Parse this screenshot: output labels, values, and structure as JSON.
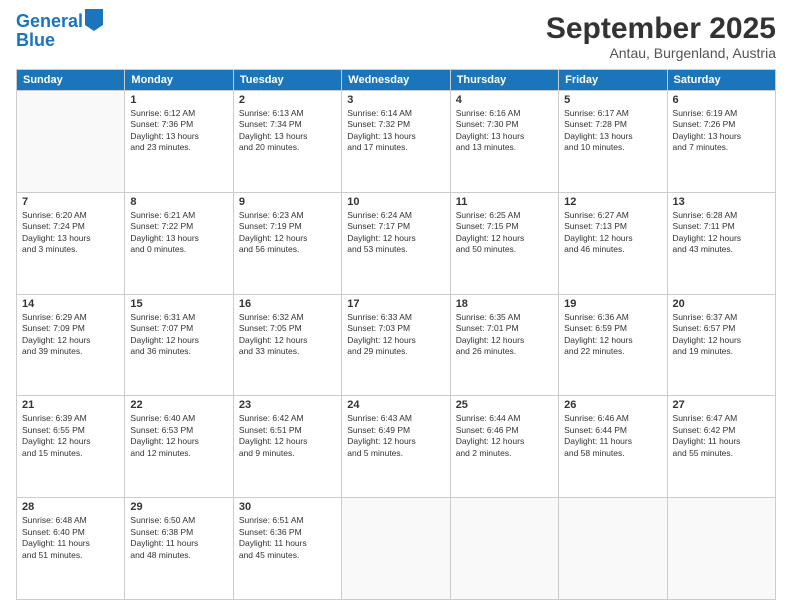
{
  "header": {
    "logo_line1": "General",
    "logo_line2": "Blue",
    "month": "September 2025",
    "location": "Antau, Burgenland, Austria"
  },
  "weekdays": [
    "Sunday",
    "Monday",
    "Tuesday",
    "Wednesday",
    "Thursday",
    "Friday",
    "Saturday"
  ],
  "weeks": [
    [
      {
        "day": "",
        "content": ""
      },
      {
        "day": "1",
        "content": "Sunrise: 6:12 AM\nSunset: 7:36 PM\nDaylight: 13 hours\nand 23 minutes."
      },
      {
        "day": "2",
        "content": "Sunrise: 6:13 AM\nSunset: 7:34 PM\nDaylight: 13 hours\nand 20 minutes."
      },
      {
        "day": "3",
        "content": "Sunrise: 6:14 AM\nSunset: 7:32 PM\nDaylight: 13 hours\nand 17 minutes."
      },
      {
        "day": "4",
        "content": "Sunrise: 6:16 AM\nSunset: 7:30 PM\nDaylight: 13 hours\nand 13 minutes."
      },
      {
        "day": "5",
        "content": "Sunrise: 6:17 AM\nSunset: 7:28 PM\nDaylight: 13 hours\nand 10 minutes."
      },
      {
        "day": "6",
        "content": "Sunrise: 6:19 AM\nSunset: 7:26 PM\nDaylight: 13 hours\nand 7 minutes."
      }
    ],
    [
      {
        "day": "7",
        "content": "Sunrise: 6:20 AM\nSunset: 7:24 PM\nDaylight: 13 hours\nand 3 minutes."
      },
      {
        "day": "8",
        "content": "Sunrise: 6:21 AM\nSunset: 7:22 PM\nDaylight: 13 hours\nand 0 minutes."
      },
      {
        "day": "9",
        "content": "Sunrise: 6:23 AM\nSunset: 7:19 PM\nDaylight: 12 hours\nand 56 minutes."
      },
      {
        "day": "10",
        "content": "Sunrise: 6:24 AM\nSunset: 7:17 PM\nDaylight: 12 hours\nand 53 minutes."
      },
      {
        "day": "11",
        "content": "Sunrise: 6:25 AM\nSunset: 7:15 PM\nDaylight: 12 hours\nand 50 minutes."
      },
      {
        "day": "12",
        "content": "Sunrise: 6:27 AM\nSunset: 7:13 PM\nDaylight: 12 hours\nand 46 minutes."
      },
      {
        "day": "13",
        "content": "Sunrise: 6:28 AM\nSunset: 7:11 PM\nDaylight: 12 hours\nand 43 minutes."
      }
    ],
    [
      {
        "day": "14",
        "content": "Sunrise: 6:29 AM\nSunset: 7:09 PM\nDaylight: 12 hours\nand 39 minutes."
      },
      {
        "day": "15",
        "content": "Sunrise: 6:31 AM\nSunset: 7:07 PM\nDaylight: 12 hours\nand 36 minutes."
      },
      {
        "day": "16",
        "content": "Sunrise: 6:32 AM\nSunset: 7:05 PM\nDaylight: 12 hours\nand 33 minutes."
      },
      {
        "day": "17",
        "content": "Sunrise: 6:33 AM\nSunset: 7:03 PM\nDaylight: 12 hours\nand 29 minutes."
      },
      {
        "day": "18",
        "content": "Sunrise: 6:35 AM\nSunset: 7:01 PM\nDaylight: 12 hours\nand 26 minutes."
      },
      {
        "day": "19",
        "content": "Sunrise: 6:36 AM\nSunset: 6:59 PM\nDaylight: 12 hours\nand 22 minutes."
      },
      {
        "day": "20",
        "content": "Sunrise: 6:37 AM\nSunset: 6:57 PM\nDaylight: 12 hours\nand 19 minutes."
      }
    ],
    [
      {
        "day": "21",
        "content": "Sunrise: 6:39 AM\nSunset: 6:55 PM\nDaylight: 12 hours\nand 15 minutes."
      },
      {
        "day": "22",
        "content": "Sunrise: 6:40 AM\nSunset: 6:53 PM\nDaylight: 12 hours\nand 12 minutes."
      },
      {
        "day": "23",
        "content": "Sunrise: 6:42 AM\nSunset: 6:51 PM\nDaylight: 12 hours\nand 9 minutes."
      },
      {
        "day": "24",
        "content": "Sunrise: 6:43 AM\nSunset: 6:49 PM\nDaylight: 12 hours\nand 5 minutes."
      },
      {
        "day": "25",
        "content": "Sunrise: 6:44 AM\nSunset: 6:46 PM\nDaylight: 12 hours\nand 2 minutes."
      },
      {
        "day": "26",
        "content": "Sunrise: 6:46 AM\nSunset: 6:44 PM\nDaylight: 11 hours\nand 58 minutes."
      },
      {
        "day": "27",
        "content": "Sunrise: 6:47 AM\nSunset: 6:42 PM\nDaylight: 11 hours\nand 55 minutes."
      }
    ],
    [
      {
        "day": "28",
        "content": "Sunrise: 6:48 AM\nSunset: 6:40 PM\nDaylight: 11 hours\nand 51 minutes."
      },
      {
        "day": "29",
        "content": "Sunrise: 6:50 AM\nSunset: 6:38 PM\nDaylight: 11 hours\nand 48 minutes."
      },
      {
        "day": "30",
        "content": "Sunrise: 6:51 AM\nSunset: 6:36 PM\nDaylight: 11 hours\nand 45 minutes."
      },
      {
        "day": "",
        "content": ""
      },
      {
        "day": "",
        "content": ""
      },
      {
        "day": "",
        "content": ""
      },
      {
        "day": "",
        "content": ""
      }
    ]
  ]
}
